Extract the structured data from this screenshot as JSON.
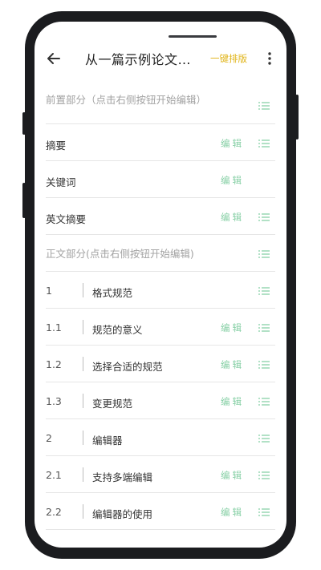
{
  "header": {
    "title": "从一篇示例论文…",
    "action_label": "一键排版"
  },
  "icons": {
    "back": "arrow-left-icon",
    "more": "more-vertical-icon",
    "drag": "list-menu-icon"
  },
  "colors": {
    "accent_yellow": "#e0b418",
    "edit_green": "#85cfa4",
    "menu_green": "#85cfa4",
    "muted_text": "#a2a2a2",
    "divider": "#e6e6e6"
  },
  "sections": {
    "front_header": "前置部分（点击右侧按钮开始编辑）",
    "abstract": {
      "label": "摘要",
      "edit": "编辑"
    },
    "keywords": {
      "label": "关键词",
      "edit": "编辑"
    },
    "en_abstract": {
      "label": "英文摘要",
      "edit": "编辑"
    },
    "body_header": "正文部分(点击右侧按钮开始编辑)"
  },
  "outline": [
    {
      "num": "1",
      "title": "格式规范",
      "edit": ""
    },
    {
      "num": "1.1",
      "title": "规范的意义",
      "edit": "编辑"
    },
    {
      "num": "1.2",
      "title": "选择合适的规范",
      "edit": "编辑"
    },
    {
      "num": "1.3",
      "title": "变更规范",
      "edit": "编辑"
    },
    {
      "num": "2",
      "title": "编辑器",
      "edit": ""
    },
    {
      "num": "2.1",
      "title": "支持多端编辑",
      "edit": "编辑"
    },
    {
      "num": "2.2",
      "title": "编辑器的使用",
      "edit": "编辑"
    }
  ]
}
